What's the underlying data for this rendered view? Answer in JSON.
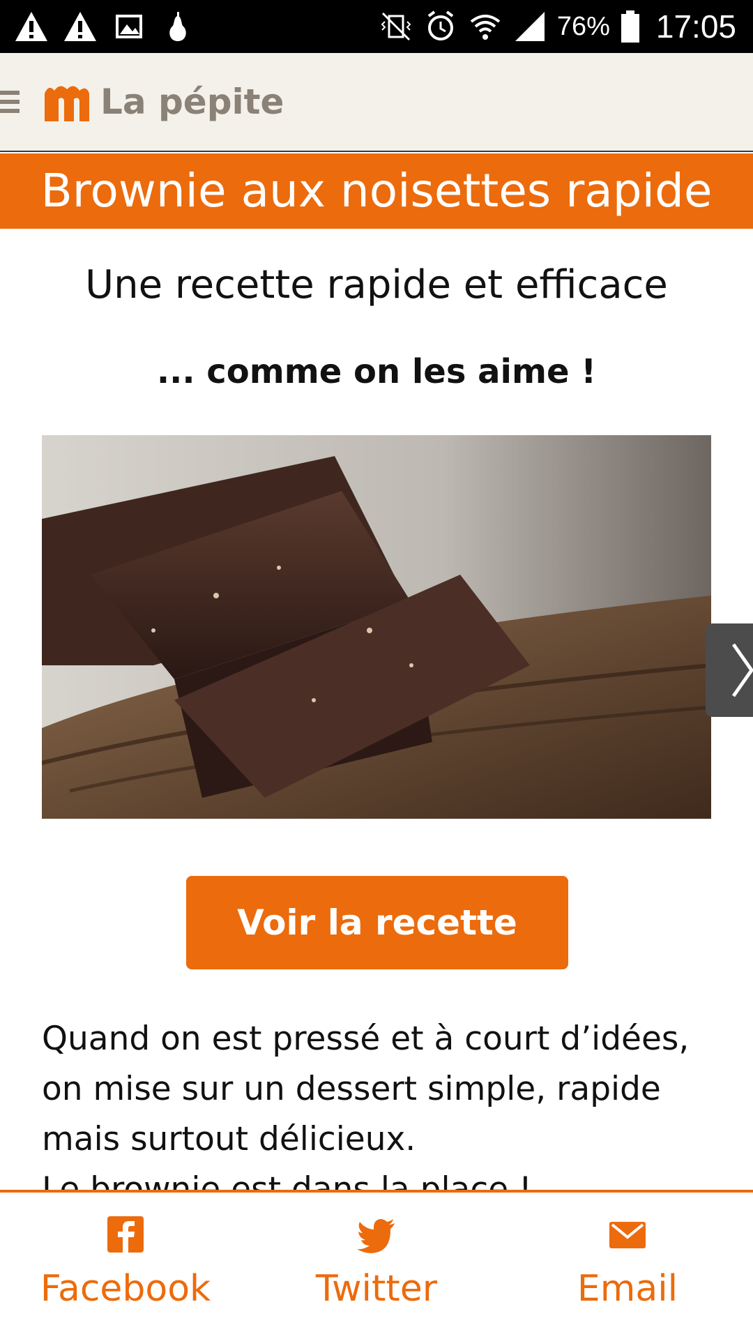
{
  "status_bar": {
    "battery_percent": "76%",
    "time": "17:05",
    "left_icons": [
      "warning-icon",
      "warning-icon",
      "image-icon",
      "pear-icon"
    ],
    "right_icons": [
      "vibrate-icon",
      "alarm-icon",
      "wifi-icon",
      "signal-icon",
      "battery-icon"
    ]
  },
  "app_bar": {
    "brand": "La pépite",
    "menu_icon": "menu-icon",
    "logo_icon": "marmiton-logo-icon"
  },
  "article": {
    "title": "Brownie aux noisettes rapide",
    "subtitle": "Une recette rapide et efficace",
    "tagline": "... comme on les aime !",
    "cta_label": "Voir la recette",
    "intro": "Quand on est pressé et à court d’idées, on mise sur un dessert simple, rapide mais surtout délicieux.",
    "intro_partial_line": "Le brownie est dans la place !"
  },
  "share": {
    "items": [
      {
        "label": "Facebook",
        "icon": "facebook-icon"
      },
      {
        "label": "Twitter",
        "icon": "twitter-icon"
      },
      {
        "label": "Email",
        "icon": "email-icon"
      }
    ]
  },
  "colors": {
    "accent": "#ec6b0c",
    "header_bg": "#f4f1ea",
    "brand_text": "#8a8177"
  }
}
